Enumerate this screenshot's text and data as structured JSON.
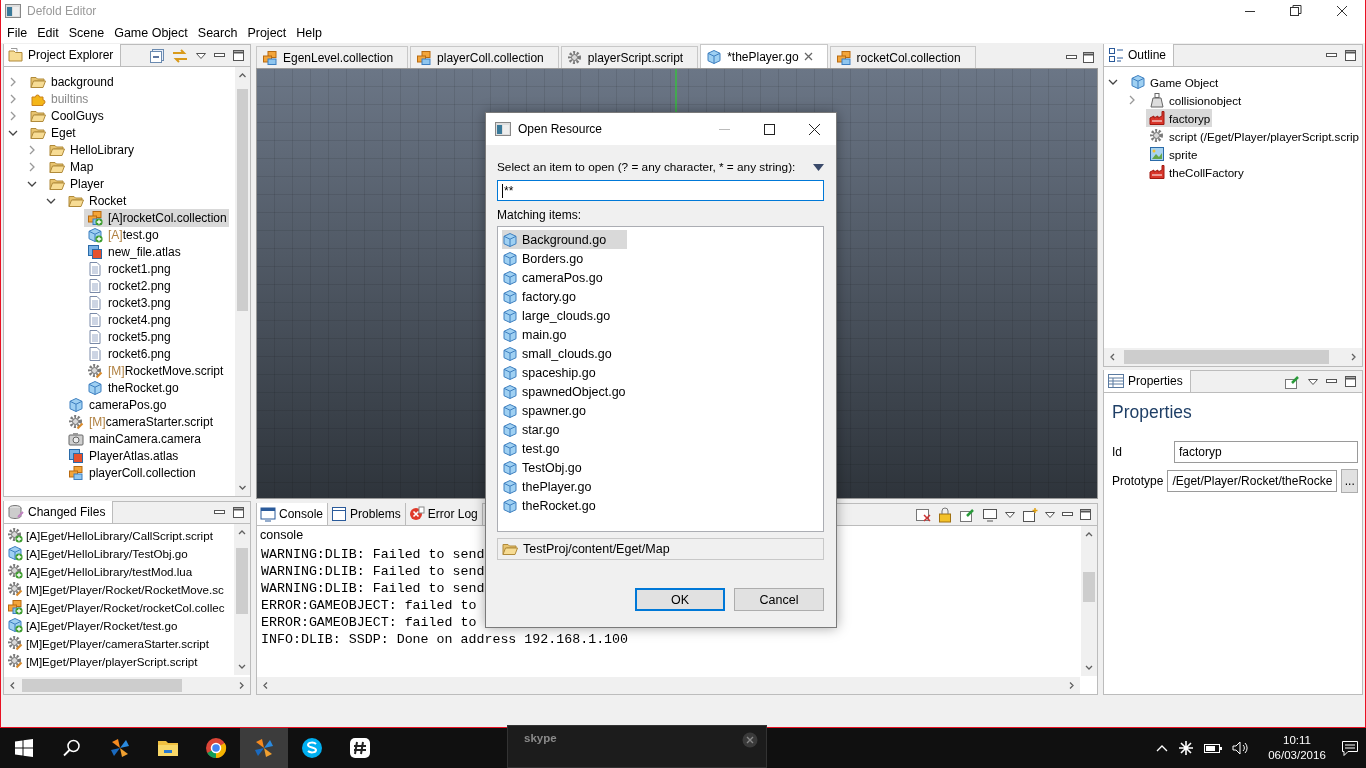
{
  "window": {
    "title": "Defold Editor"
  },
  "menu": [
    "File",
    "Edit",
    "Scene",
    "Game Object",
    "Search",
    "Project",
    "Help"
  ],
  "project_explorer": {
    "title": "Project Explorer",
    "items": [
      {
        "kind": "folder",
        "label": "background",
        "expanded": false,
        "selected": false
      },
      {
        "kind": "library",
        "label": "builtins",
        "expanded": false,
        "selected": false
      },
      {
        "kind": "folder",
        "label": "CoolGuys",
        "expanded": false,
        "selected": false
      },
      {
        "kind": "folder",
        "label": "Eget",
        "expanded": true,
        "selected": false,
        "children": [
          {
            "kind": "folder",
            "label": "HelloLibrary",
            "expanded": false,
            "selected": false
          },
          {
            "kind": "folder",
            "label": "Map",
            "expanded": false,
            "selected": false
          },
          {
            "kind": "folder",
            "label": "Player",
            "expanded": true,
            "selected": false,
            "children": [
              {
                "kind": "folder",
                "label": "Rocket",
                "expanded": true,
                "selected": false,
                "children": [
                  {
                    "kind": "collection-new",
                    "prefix": "[A]",
                    "label": "rocketCol.collection",
                    "selected": true
                  },
                  {
                    "kind": "go-new",
                    "prefix": "[A]",
                    "label": "test.go",
                    "selected": false
                  },
                  {
                    "kind": "atlas",
                    "label": "new_file.atlas",
                    "selected": false
                  },
                  {
                    "kind": "image",
                    "label": "rocket1.png",
                    "selected": false
                  },
                  {
                    "kind": "image",
                    "label": "rocket2.png",
                    "selected": false
                  },
                  {
                    "kind": "image",
                    "label": "rocket3.png",
                    "selected": false
                  },
                  {
                    "kind": "image",
                    "label": "rocket4.png",
                    "selected": false
                  },
                  {
                    "kind": "image",
                    "label": "rocket5.png",
                    "selected": false
                  },
                  {
                    "kind": "image",
                    "label": "rocket6.png",
                    "selected": false
                  },
                  {
                    "kind": "script-modified",
                    "prefix": "[M]",
                    "label": "RocketMove.script",
                    "selected": false
                  },
                  {
                    "kind": "go",
                    "label": "theRocket.go",
                    "selected": false
                  }
                ]
              },
              {
                "kind": "go",
                "label": "cameraPos.go",
                "selected": false
              },
              {
                "kind": "script-modified",
                "prefix": "[M]",
                "label": "cameraStarter.script",
                "selected": false
              },
              {
                "kind": "camera",
                "label": "mainCamera.camera",
                "selected": false
              },
              {
                "kind": "atlas",
                "label": "PlayerAtlas.atlas",
                "selected": false
              },
              {
                "kind": "collection",
                "label": "playerColl.collection",
                "selected": false
              }
            ]
          }
        ]
      }
    ]
  },
  "changed_files": {
    "title": "Changed Files",
    "items": [
      {
        "kind": "script-new",
        "label": "[A]Eget/HelloLibrary/CallScript.script"
      },
      {
        "kind": "go-new",
        "label": "[A]Eget/HelloLibrary/TestObj.go"
      },
      {
        "kind": "script-new",
        "label": "[A]Eget/HelloLibrary/testMod.lua"
      },
      {
        "kind": "script-modified",
        "label": "[M]Eget/Player/Rocket/RocketMove.sc"
      },
      {
        "kind": "collection-new",
        "label": "[A]Eget/Player/Rocket/rocketCol.collec"
      },
      {
        "kind": "go-new",
        "label": "[A]Eget/Player/Rocket/test.go"
      },
      {
        "kind": "script-modified",
        "label": "[M]Eget/Player/cameraStarter.script"
      },
      {
        "kind": "script-modified",
        "label": "[M]Eget/Player/playerScript.script"
      }
    ]
  },
  "editor_tabs": [
    {
      "kind": "collection",
      "label": "EgenLevel.collection",
      "selected": false
    },
    {
      "kind": "collection",
      "label": "playerColl.collection",
      "selected": false
    },
    {
      "kind": "script",
      "label": "playerScript.script",
      "selected": false
    },
    {
      "kind": "go",
      "label": "*thePlayer.go",
      "selected": true
    },
    {
      "kind": "collection",
      "label": "rocketCol.collection",
      "selected": false
    }
  ],
  "console": {
    "tabs": [
      {
        "kind": "console",
        "label": "Console",
        "selected": true
      },
      {
        "kind": "problems",
        "label": "Problems",
        "selected": false
      },
      {
        "kind": "log",
        "label": "Error Log",
        "selected": false
      }
    ],
    "title": "console",
    "lines": [
      "WARNING:DLIB: Failed to send",
      "WARNING:DLIB: Failed to send",
      "WARNING:DLIB: Failed to send",
      "ERROR:GAMEOBJECT: failed to",
      "ERROR:GAMEOBJECT: failed to",
      "INFO:DLIB: SSDP: Done on address 192.168.1.100"
    ]
  },
  "outline": {
    "title": "Outline",
    "items": [
      {
        "kind": "go",
        "label": "Game Object",
        "expanded": true,
        "selected": false,
        "children": [
          {
            "kind": "collision",
            "label": "collisionobject",
            "expanded": false,
            "selected": false
          },
          {
            "kind": "factory",
            "label": "factoryp",
            "selected": true
          },
          {
            "kind": "script",
            "label": "script (/Eget/Player/playerScript.scrip",
            "selected": false
          },
          {
            "kind": "sprite",
            "label": "sprite",
            "selected": false
          },
          {
            "kind": "factory",
            "label": "theCollFactory",
            "selected": false
          }
        ]
      }
    ]
  },
  "properties": {
    "tab": "Properties",
    "heading": "Properties",
    "fields": [
      {
        "label": "Id",
        "value": "factoryp"
      },
      {
        "label": "Prototype",
        "value": "/Eget/Player/Rocket/theRocke",
        "button": "..."
      }
    ]
  },
  "dialog": {
    "title": "Open Resource",
    "prompt": "Select an item to open (? = any character, * = any string):",
    "filter": "**",
    "list_label": "Matching items:",
    "items": [
      {
        "label": "Background.go",
        "selected": true
      },
      {
        "label": "Borders.go",
        "selected": false
      },
      {
        "label": "cameraPos.go",
        "selected": false
      },
      {
        "label": "factory.go",
        "selected": false
      },
      {
        "label": "large_clouds.go",
        "selected": false
      },
      {
        "label": "main.go",
        "selected": false
      },
      {
        "label": "small_clouds.go",
        "selected": false
      },
      {
        "label": "spaceship.go",
        "selected": false
      },
      {
        "label": "spawnedObject.go",
        "selected": false
      },
      {
        "label": "spawner.go",
        "selected": false
      },
      {
        "label": "star.go",
        "selected": false
      },
      {
        "label": "test.go",
        "selected": false
      },
      {
        "label": "TestObj.go",
        "selected": false
      },
      {
        "label": "thePlayer.go",
        "selected": false
      },
      {
        "label": "theRocket.go",
        "selected": false
      }
    ],
    "location": "TestProj/content/Eget/Map",
    "buttons": [
      {
        "label": "OK",
        "default": true
      },
      {
        "label": "Cancel",
        "default": false
      }
    ]
  },
  "taskbar": {
    "apps": [
      {
        "kind": "defold",
        "active": false
      },
      {
        "kind": "explorer",
        "active": false
      },
      {
        "kind": "chrome",
        "active": false
      },
      {
        "kind": "defold",
        "active": true
      },
      {
        "kind": "skype",
        "active": false
      },
      {
        "kind": "slack",
        "active": false
      }
    ],
    "preview": {
      "title": "skype"
    },
    "time": "10:11",
    "date": "06/03/2016"
  }
}
